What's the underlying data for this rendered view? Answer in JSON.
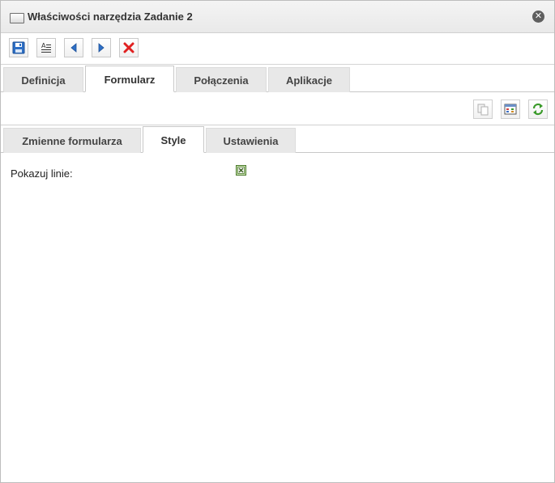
{
  "window": {
    "title": "Właściwości narzędzia Zadanie 2"
  },
  "toolbar": {
    "buttons": [
      {
        "name": "save",
        "icon": "floppy-disk-icon"
      },
      {
        "name": "text",
        "icon": "text-lines-icon"
      },
      {
        "name": "previous",
        "icon": "arrow-left-icon"
      },
      {
        "name": "next",
        "icon": "arrow-right-icon"
      },
      {
        "name": "delete",
        "icon": "red-x-icon"
      }
    ]
  },
  "main_tabs": [
    {
      "label": "Definicja",
      "active": false
    },
    {
      "label": "Formularz",
      "active": true
    },
    {
      "label": "Połączenia",
      "active": false
    },
    {
      "label": "Aplikacje",
      "active": false
    }
  ],
  "actions": [
    {
      "name": "copy",
      "icon": "copy-icon"
    },
    {
      "name": "grid",
      "icon": "grid-icon"
    },
    {
      "name": "refresh",
      "icon": "refresh-icon"
    }
  ],
  "sub_tabs": [
    {
      "label": "Zmienne formularza",
      "active": false
    },
    {
      "label": "Style",
      "active": true
    },
    {
      "label": "Ustawienia",
      "active": false
    }
  ],
  "form": {
    "show_lines_label": "Pokazuj linie:",
    "show_lines_checked": true
  },
  "colors": {
    "tab_inactive": "#e8e8e8",
    "tab_active": "#ffffff",
    "accent_blue": "#2d6fc6",
    "delete_red": "#e02020",
    "refresh_green": "#3a9a2a",
    "checkbox_green": "#c9e2b0"
  }
}
